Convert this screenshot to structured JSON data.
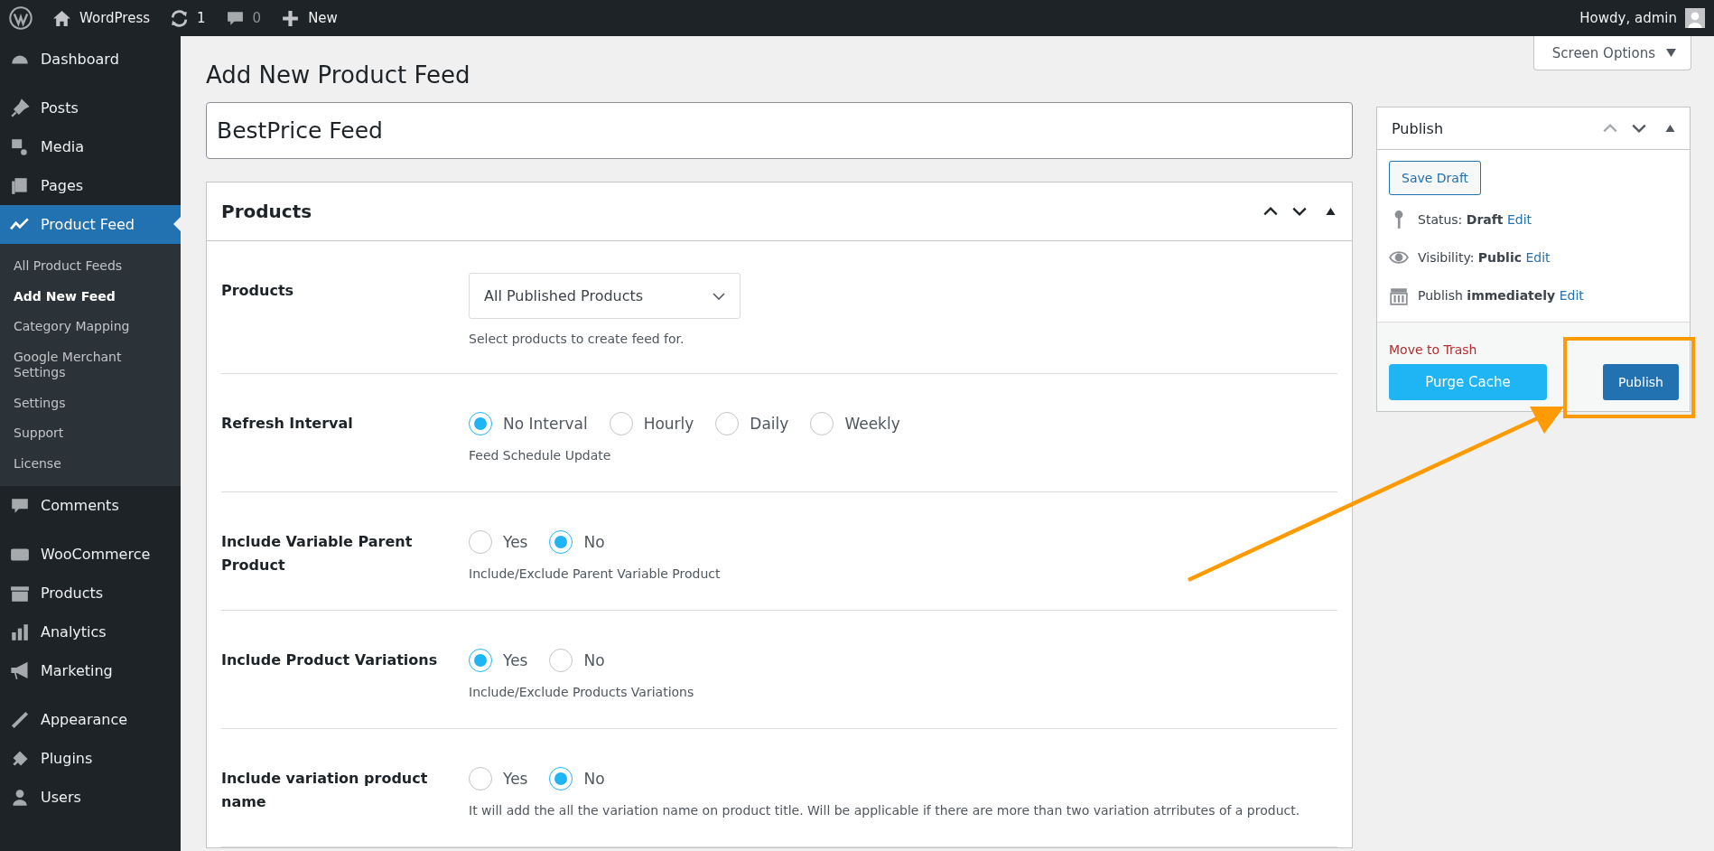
{
  "admin_bar": {
    "site": "WordPress",
    "updates": "1",
    "comments": "0",
    "new": "New",
    "greeting": "Howdy, admin"
  },
  "sidebar": {
    "groups": [
      [
        {
          "label": "Dashboard",
          "selected": false
        }
      ],
      [
        {
          "label": "Posts",
          "selected": false
        },
        {
          "label": "Media",
          "selected": false
        },
        {
          "label": "Pages",
          "selected": false
        },
        {
          "label": "Product Feed",
          "selected": true,
          "children": [
            {
              "label": "All Product Feeds",
              "selected": false
            },
            {
              "label": "Add New Feed",
              "selected": true
            },
            {
              "label": "Category Mapping",
              "selected": false
            },
            {
              "label": "Google Merchant Settings",
              "selected": false
            },
            {
              "label": "Settings",
              "selected": false
            },
            {
              "label": "Support",
              "selected": false
            },
            {
              "label": "License",
              "selected": false
            }
          ]
        }
      ],
      [
        {
          "label": "Comments",
          "selected": false
        }
      ],
      [
        {
          "label": "WooCommerce",
          "selected": false
        },
        {
          "label": "Products",
          "selected": false
        },
        {
          "label": "Analytics",
          "selected": false
        },
        {
          "label": "Marketing",
          "selected": false
        }
      ],
      [
        {
          "label": "Appearance",
          "selected": false
        },
        {
          "label": "Plugins",
          "selected": false
        },
        {
          "label": "Users",
          "selected": false
        }
      ]
    ]
  },
  "screen_options": "Screen Options",
  "page_title": "Add New Product Feed",
  "feed_title": {
    "value": "BestPrice Feed"
  },
  "products_box": {
    "title": "Products",
    "rows": [
      {
        "kind": "select",
        "label": "Products",
        "value": "All Published Products",
        "description": "Select products to create feed for."
      },
      {
        "kind": "radio",
        "label": "Refresh Interval",
        "options": [
          {
            "label": "No Interval",
            "selected": true
          },
          {
            "label": "Hourly",
            "selected": false
          },
          {
            "label": "Daily",
            "selected": false
          },
          {
            "label": "Weekly",
            "selected": false
          }
        ],
        "description": "Feed Schedule Update"
      },
      {
        "kind": "radio",
        "label": "Include Variable Parent Product",
        "options": [
          {
            "label": "Yes",
            "selected": false
          },
          {
            "label": "No",
            "selected": true
          }
        ],
        "description": "Include/Exclude Parent Variable Product"
      },
      {
        "kind": "radio",
        "label": "Include Product Variations",
        "options": [
          {
            "label": "Yes",
            "selected": true
          },
          {
            "label": "No",
            "selected": false
          }
        ],
        "description": "Include/Exclude Products Variations"
      },
      {
        "kind": "radio",
        "label": "Include variation product name",
        "options": [
          {
            "label": "Yes",
            "selected": false
          },
          {
            "label": "No",
            "selected": true
          }
        ],
        "description": "It will add the all the variation name on product title. Will be applicable if there are more than two variation atrributes of a product."
      }
    ]
  },
  "publish_box": {
    "title": "Publish",
    "save_draft": "Save Draft",
    "lines": [
      {
        "text": "Status: **Draft**",
        "link": "Edit"
      },
      {
        "text": "Visibility: **Public**",
        "link": "Edit"
      },
      {
        "text": "Publish **immediately**",
        "link": "Edit"
      }
    ],
    "trash": "Move to Trash",
    "purge": "Purge Cache",
    "publish": "Publish"
  }
}
